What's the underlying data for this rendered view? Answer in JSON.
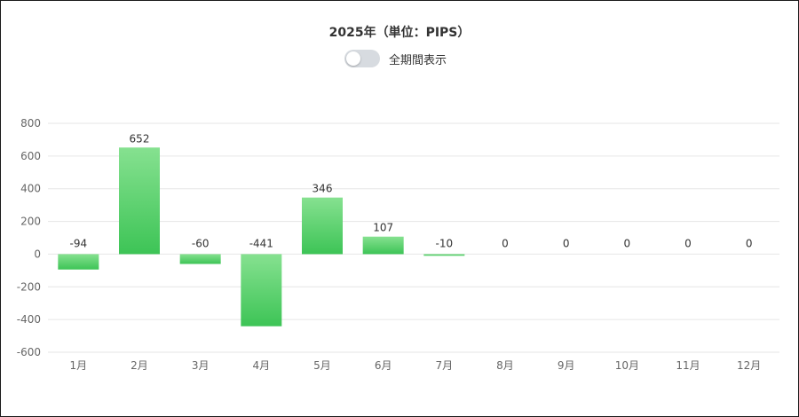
{
  "title": "2025年（単位：PIPS）",
  "toggle": {
    "label": "全期間表示",
    "checked": false
  },
  "colors": {
    "bar_top": "#86e190",
    "bar_bottom": "#3dc456",
    "grid": "#e6e6e6",
    "axis_text": "#666666",
    "label_text": "#333333"
  },
  "chart_data": {
    "type": "bar",
    "title": "2025年（単位：PIPS）",
    "xlabel": "",
    "ylabel": "",
    "categories": [
      "1月",
      "2月",
      "3月",
      "4月",
      "5月",
      "6月",
      "7月",
      "8月",
      "9月",
      "10月",
      "11月",
      "12月"
    ],
    "values": [
      -94,
      652,
      -60,
      -441,
      346,
      107,
      -10,
      0,
      0,
      0,
      0,
      0
    ],
    "data_labels": [
      "-94",
      "652",
      "-60",
      "-441",
      "346",
      "107",
      "-10",
      "0",
      "0",
      "0",
      "0",
      "0"
    ],
    "ylim": [
      -600,
      800
    ],
    "yticks": [
      800,
      600,
      400,
      200,
      0,
      -200,
      -400,
      -600
    ],
    "ytick_labels": [
      "800",
      "600",
      "400",
      "200",
      "0",
      "-200",
      "-400",
      "-600"
    ],
    "grid": true,
    "legend": "none"
  }
}
